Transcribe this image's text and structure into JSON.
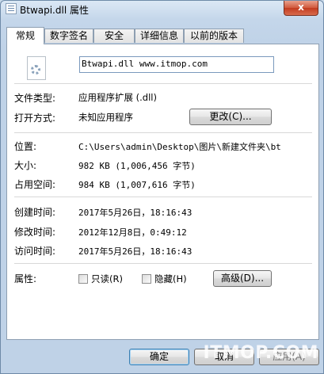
{
  "window": {
    "title": "Btwapi.dll 属性",
    "close_label": "x"
  },
  "tabs": [
    {
      "label": "常规",
      "active": true
    },
    {
      "label": "数字签名"
    },
    {
      "label": "安全"
    },
    {
      "label": "详细信息"
    },
    {
      "label": "以前的版本"
    }
  ],
  "general": {
    "file_name": "Btwapi.dll www.itmop.com",
    "file_type_label": "文件类型:",
    "file_type_value": "应用程序扩展 (.dll)",
    "open_with_label": "打开方式:",
    "open_with_value": "未知应用程序",
    "change_button": "更改(C)...",
    "location_label": "位置:",
    "location_value": "C:\\Users\\admin\\Desktop\\图片\\新建文件夹\\bt",
    "size_label": "大小:",
    "size_value": "982 KB (1,006,456 字节)",
    "size_on_disk_label": "占用空间:",
    "size_on_disk_value": "984 KB (1,007,616 字节)",
    "created_label": "创建时间:",
    "created_value": "2017年5月26日，18:16:43",
    "modified_label": "修改时间:",
    "modified_value": "2012年12月8日，0:49:12",
    "accessed_label": "访问时间:",
    "accessed_value": "2017年5月26日，18:16:43",
    "attributes_label": "属性:",
    "readonly_label": "只读(R)",
    "hidden_label": "隐藏(H)",
    "advanced_button": "高级(D)..."
  },
  "footer": {
    "ok": "确定",
    "cancel": "取消",
    "apply": "应用(A)"
  },
  "watermark": "ITMOP.COM"
}
